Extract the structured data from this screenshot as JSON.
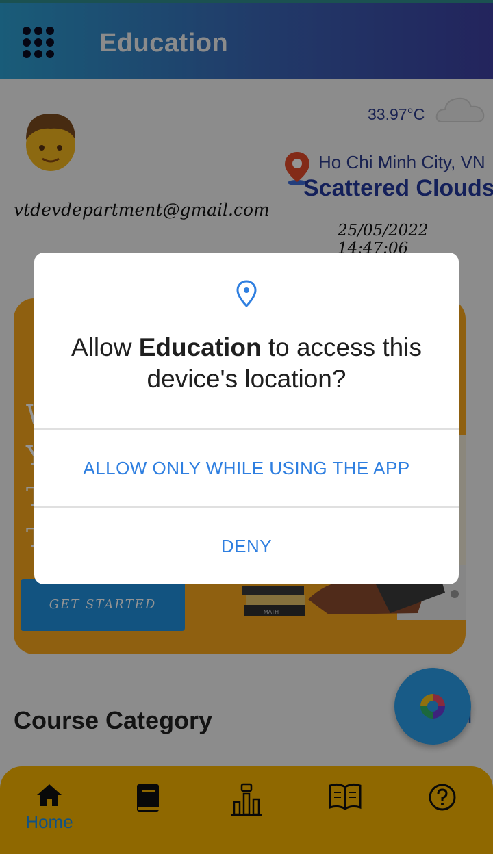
{
  "appbar": {
    "title": "Education"
  },
  "profile": {
    "email": "vtdevdepartment@gmail.com",
    "datetime": "25/05/2022 14:47:06"
  },
  "weather": {
    "temperature": "33.97°C",
    "city": "Ho Chi Minh City, VN",
    "description": "Scattered Clouds"
  },
  "banner": {
    "letters": [
      "W",
      "Y",
      "T",
      "T"
    ],
    "book_label": "MATH",
    "button_label": "GET STARTED"
  },
  "section": {
    "title": "Course Category",
    "view_all_partial": "ll"
  },
  "bottom_nav": {
    "items": [
      {
        "icon": "home-icon",
        "label": "Home",
        "active": true
      },
      {
        "icon": "book-icon",
        "label": ""
      },
      {
        "icon": "leaderboard-icon",
        "label": ""
      },
      {
        "icon": "open-book-icon",
        "label": ""
      },
      {
        "icon": "help-icon",
        "label": ""
      }
    ]
  },
  "dialog": {
    "icon": "location-pin-icon",
    "message_prefix": "Allow ",
    "app_name": "Education",
    "message_suffix": " to access this device's location?",
    "allow_label": "ALLOW ONLY WHILE USING THE APP",
    "deny_label": "DENY"
  },
  "colors": {
    "accent": "#2f7fe0",
    "nav_bg": "#f6b400",
    "banner_bg": "#f6a51c",
    "weather_text": "#23389c"
  }
}
